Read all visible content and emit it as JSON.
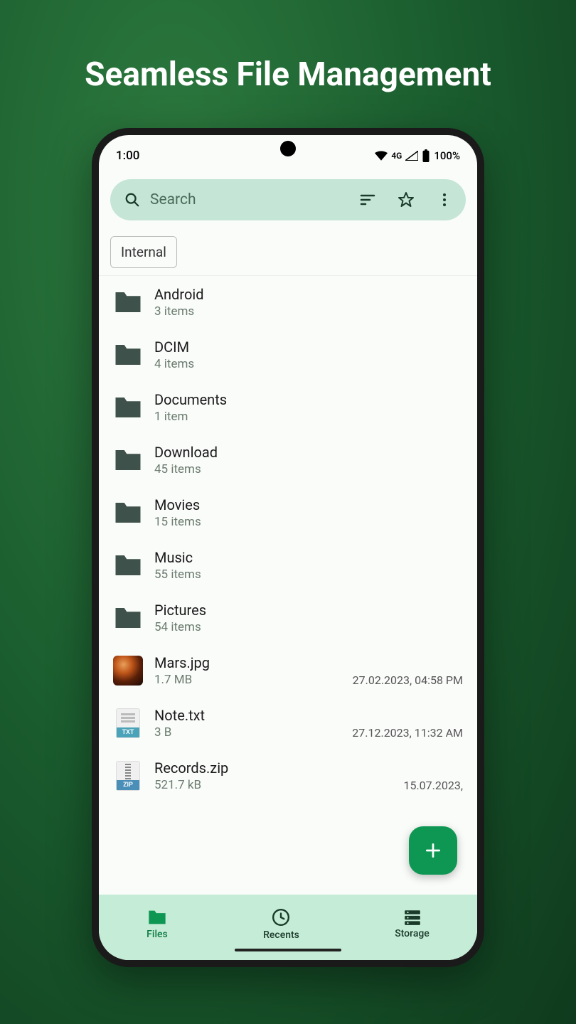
{
  "promo": {
    "title": "Seamless File Management"
  },
  "status": {
    "time": "1:00",
    "network": "4G",
    "battery": "100%"
  },
  "search": {
    "placeholder": "Search"
  },
  "breadcrumb": {
    "current": "Internal"
  },
  "items": [
    {
      "type": "folder",
      "name": "Android",
      "sub": "3 items",
      "date": ""
    },
    {
      "type": "folder",
      "name": "DCIM",
      "sub": "4 items",
      "date": ""
    },
    {
      "type": "folder",
      "name": "Documents",
      "sub": "1 item",
      "date": ""
    },
    {
      "type": "folder",
      "name": "Download",
      "sub": "45 items",
      "date": ""
    },
    {
      "type": "folder",
      "name": "Movies",
      "sub": "15 items",
      "date": ""
    },
    {
      "type": "folder",
      "name": "Music",
      "sub": "55 items",
      "date": ""
    },
    {
      "type": "folder",
      "name": "Pictures",
      "sub": "54 items",
      "date": ""
    },
    {
      "type": "image",
      "name": "Mars.jpg",
      "sub": "1.7 MB",
      "date": "27.02.2023, 04:58 PM"
    },
    {
      "type": "txt",
      "name": "Note.txt",
      "sub": "3 B",
      "date": "27.12.2023, 11:32 AM"
    },
    {
      "type": "zip",
      "name": "Records.zip",
      "sub": "521.7 kB",
      "date": "15.07.2023,"
    }
  ],
  "file_badges": {
    "txt": "TXT",
    "zip": "ZIP"
  },
  "nav": {
    "files": "Files",
    "recents": "Recents",
    "storage": "Storage"
  }
}
